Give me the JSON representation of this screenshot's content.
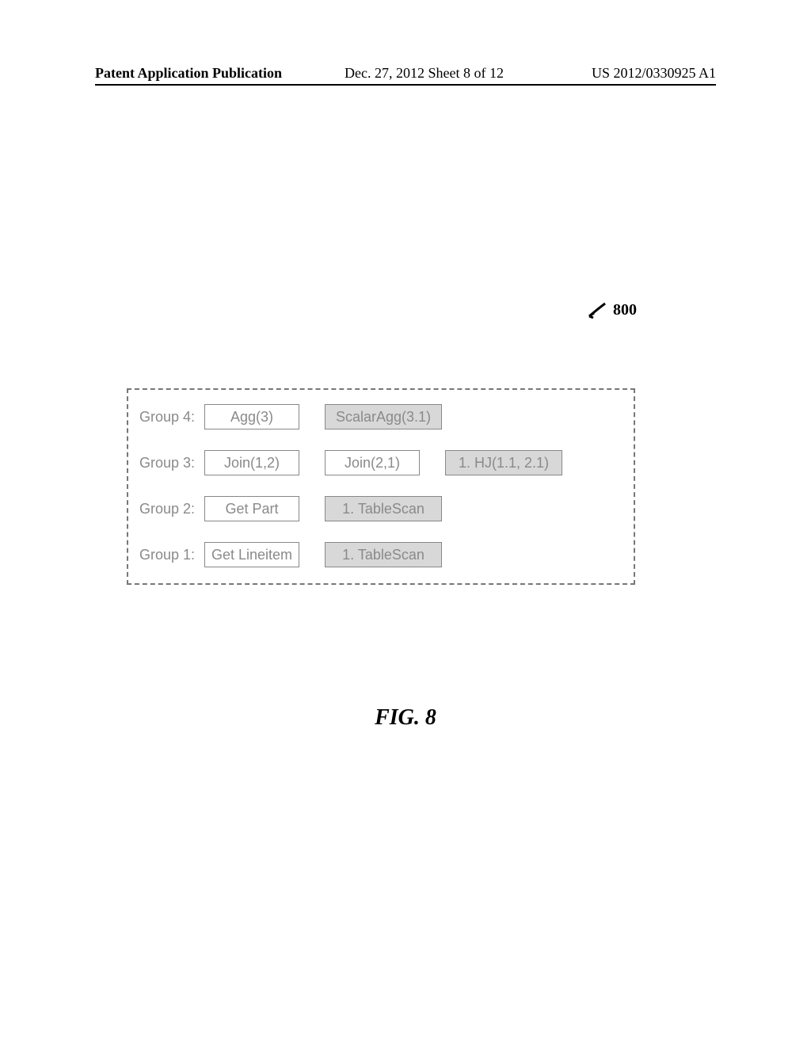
{
  "header": {
    "left": "Patent Application Publication",
    "center": "Dec. 27, 2012  Sheet 8 of 12",
    "right": "US 2012/0330925 A1"
  },
  "reference_numeral": "800",
  "diagram": {
    "rows": [
      {
        "label": "Group 4:",
        "cells": [
          {
            "text": "Agg(3)",
            "shaded": false
          },
          {
            "text": "ScalarAgg(3.1)",
            "shaded": true
          }
        ]
      },
      {
        "label": "Group 3:",
        "cells": [
          {
            "text": "Join(1,2)",
            "shaded": false
          },
          {
            "text": "Join(2,1)",
            "shaded": false
          },
          {
            "text": "1. HJ(1.1, 2.1)",
            "shaded": true
          }
        ]
      },
      {
        "label": "Group 2:",
        "cells": [
          {
            "text": "Get Part",
            "shaded": false
          },
          {
            "text": "1. TableScan",
            "shaded": true
          }
        ]
      },
      {
        "label": "Group 1:",
        "cells": [
          {
            "text": "Get Lineitem",
            "shaded": false
          },
          {
            "text": "1. TableScan",
            "shaded": true
          }
        ]
      }
    ]
  },
  "figure_caption": "FIG. 8"
}
